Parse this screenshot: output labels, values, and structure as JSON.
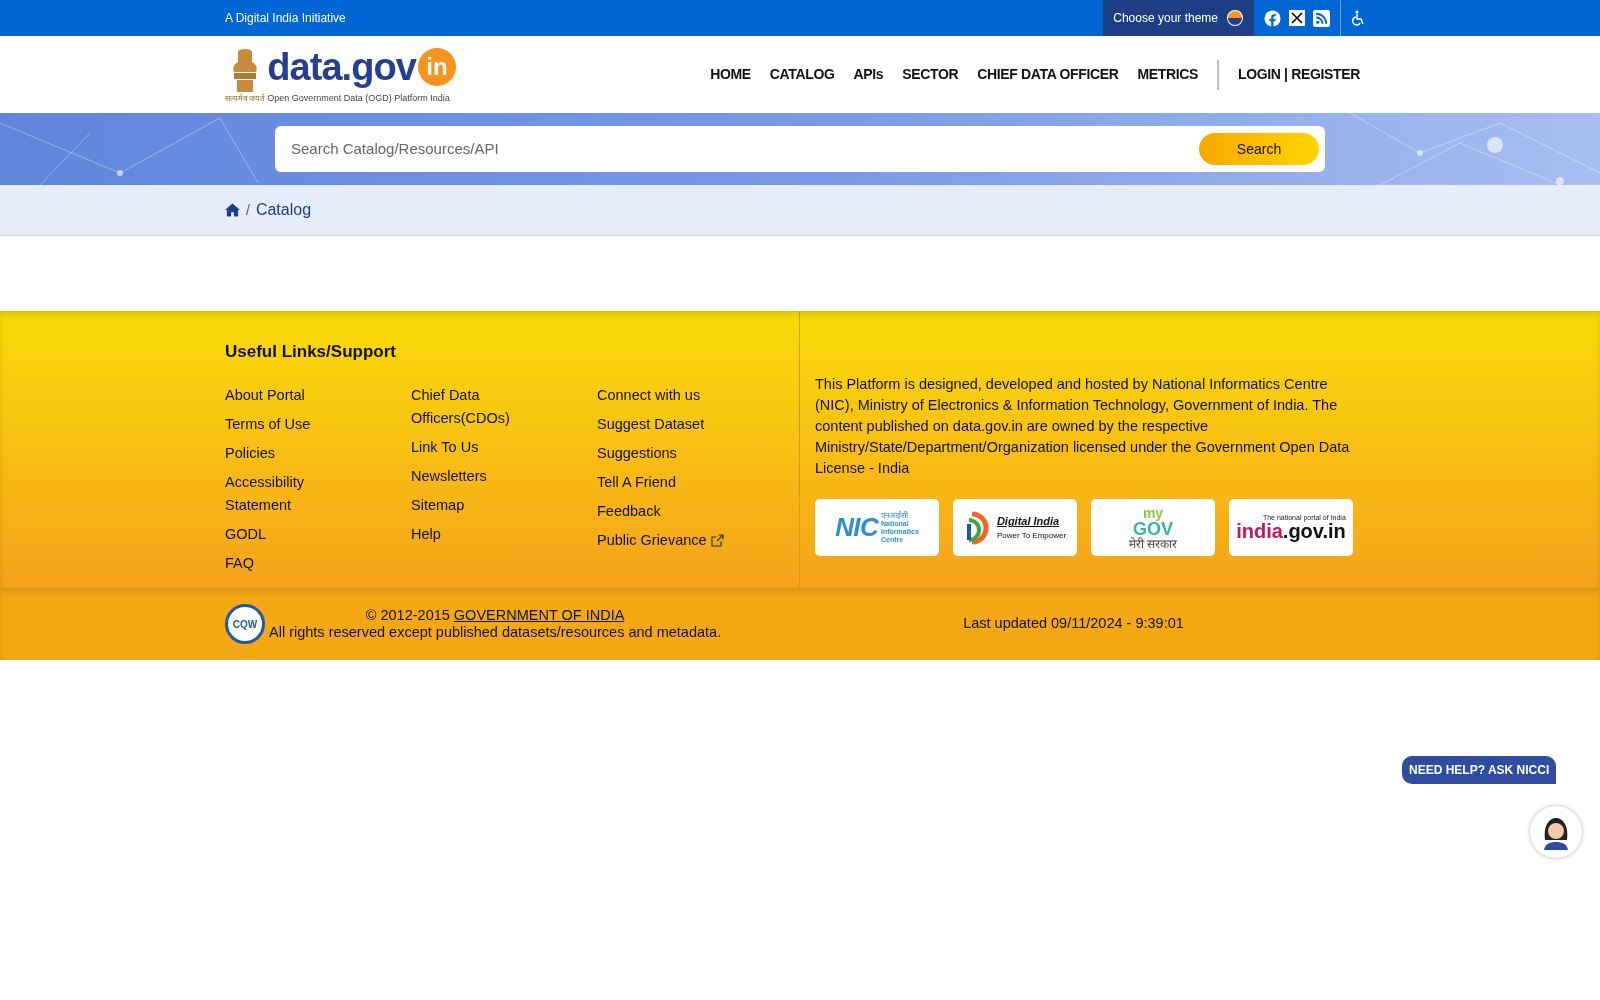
{
  "top_bar": {
    "tagline": "A Digital India Initiative",
    "theme_label": "Choose your theme"
  },
  "logo": {
    "emblem_motto": "सत्यमेव जयते",
    "name": "data.gov",
    "badge": "in",
    "subtitle": "Open Government Data (OGD) Platform India"
  },
  "nav": [
    {
      "label": "HOME"
    },
    {
      "label": "CATALOG"
    },
    {
      "label": "APIs"
    },
    {
      "label": "SECTOR"
    },
    {
      "label": "CHIEF DATA OFFICER"
    },
    {
      "label": "METRICS"
    }
  ],
  "login": "LOGIN | REGISTER",
  "search": {
    "placeholder": "Search Catalog/Resources/API",
    "button": "Search"
  },
  "breadcrumb": [
    {
      "separator": "/",
      "label": "Catalog"
    }
  ],
  "footer": {
    "heading": "Useful Links/Support",
    "columns": [
      [
        {
          "label": "About Portal"
        },
        {
          "label": "Terms of Use"
        },
        {
          "label": "Policies"
        },
        {
          "label": "Accessibility Statement"
        },
        {
          "label": "GODL"
        },
        {
          "label": "FAQ"
        }
      ],
      [
        {
          "label": "Chief Data Officers(CDOs)"
        },
        {
          "label": "Link To Us"
        },
        {
          "label": "Newsletters"
        },
        {
          "label": "Sitemap"
        },
        {
          "label": "Help"
        }
      ],
      [
        {
          "label": "Connect with us"
        },
        {
          "label": "Suggest Dataset"
        },
        {
          "label": "Suggestions"
        },
        {
          "label": "Tell A Friend"
        },
        {
          "label": "Feedback"
        },
        {
          "label": "Public Grievance",
          "external": true
        }
      ]
    ],
    "about": "This Platform is designed, developed and hosted by National Informatics Centre (NIC), Ministry of Electronics & Information Technology, Government of India. The content published on data.gov.in are owned by the respective Ministry/State/Department/Organization licensed under the Government Open Data License - India",
    "logos": [
      {
        "kind": "nic",
        "lines": [
          "NIC",
          "एनआईसी",
          "National",
          "Informatics",
          "Centre"
        ]
      },
      {
        "kind": "digital",
        "lines": [
          "Digital India",
          "Power To Empower"
        ]
      },
      {
        "kind": "mygov",
        "lines": [
          "my",
          "GOV",
          "मेरी सरकार"
        ]
      },
      {
        "kind": "indiagov",
        "lines": [
          "The national portal of India",
          "india",
          ".gov.in"
        ]
      }
    ],
    "copyright": "© 2012-2015",
    "copyright_link": "GOVERNMENT OF INDIA",
    "rights": "All rights reserved except published datasets/resources and metadata.",
    "cqw": "CQW",
    "last_updated": "Last updated 09/11/2024 - 9:39:01"
  },
  "help_button": "NEED HELP? ASK NICCI"
}
